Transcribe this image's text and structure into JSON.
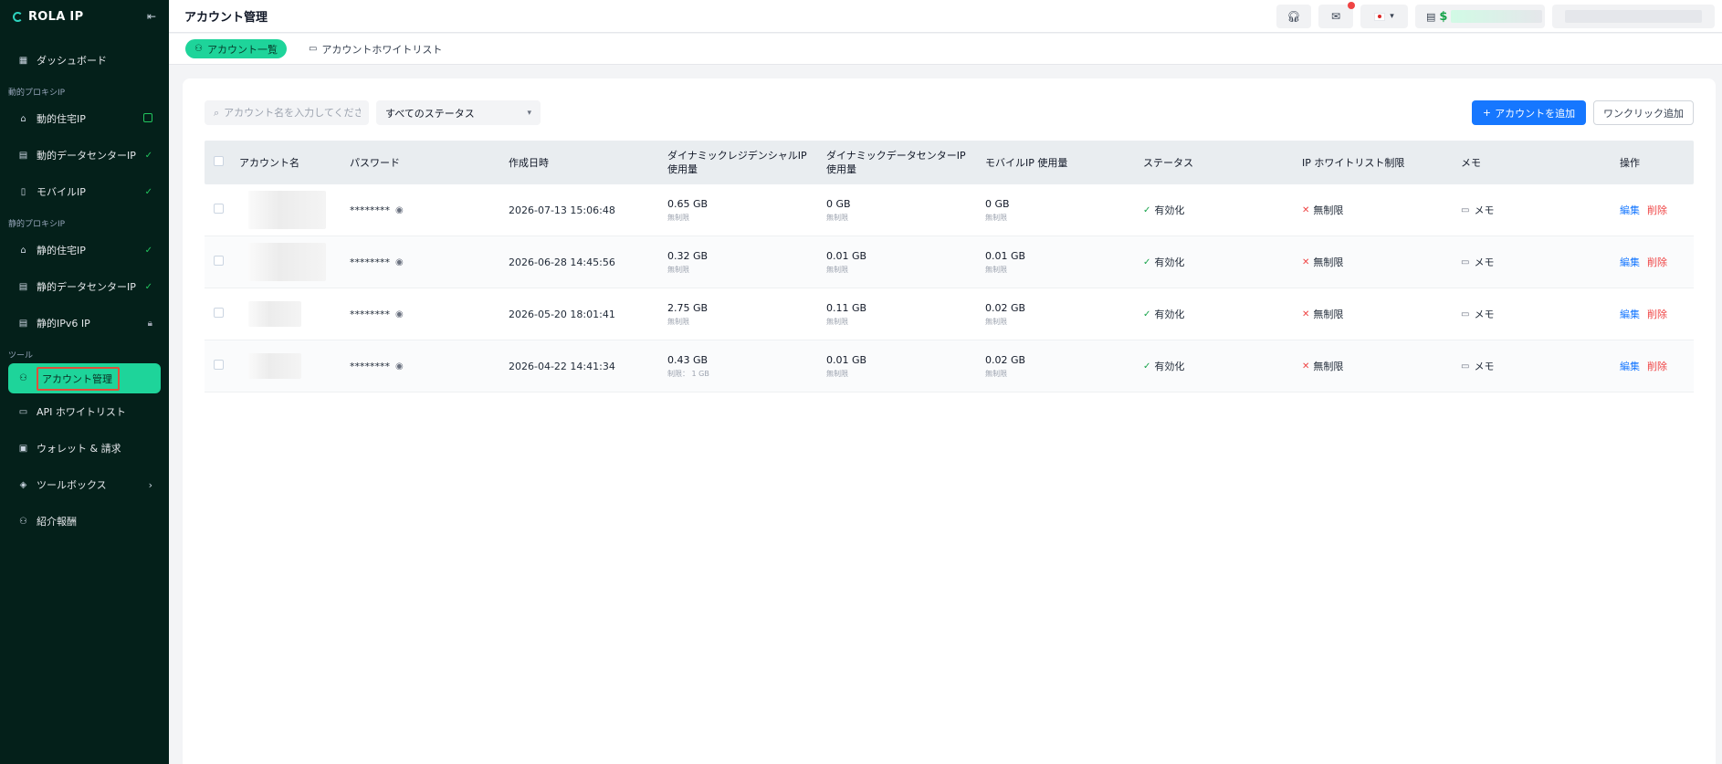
{
  "brand": {
    "name": "ROLA IP",
    "collapse_icon": "collapse-left-icon"
  },
  "sidebar": {
    "dashboard": "ダッシュボード",
    "dynamic_section": "動的プロキシIP",
    "dynamic_items": [
      {
        "label": "動的住宅IP",
        "icon": "home-icon",
        "trail": "badge"
      },
      {
        "label": "動的データセンターIP",
        "icon": "server-icon",
        "trail": "check"
      },
      {
        "label": "モバイルIP",
        "icon": "mobile-icon",
        "trail": "check"
      }
    ],
    "static_section": "静的プロキシIP",
    "static_items": [
      {
        "label": "静的住宅IP",
        "icon": "home-icon",
        "trail": "check"
      },
      {
        "label": "静的データセンターIP",
        "icon": "server-icon",
        "trail": "check"
      },
      {
        "label": "静的IPv6 IP",
        "icon": "server-icon",
        "trail": "lock"
      }
    ],
    "tools_section": "ツール",
    "tools_items": [
      {
        "label": "アカウント管理",
        "active": true
      },
      {
        "label": "API ホワイトリスト"
      },
      {
        "label": "ウォレット & 請求"
      },
      {
        "label": "ツールボックス"
      },
      {
        "label": "紹介報酬"
      }
    ]
  },
  "header": {
    "title": "アカウント管理",
    "currency": "$"
  },
  "tabs": [
    {
      "label": "アカウント一覧",
      "active": true
    },
    {
      "label": "アカウントホワイトリスト"
    }
  ],
  "toolbar": {
    "search_placeholder": "アカウント名を入力してくださ",
    "status_select": "すべてのステータス",
    "add_button": "アカウントを追加",
    "add_prefix": "+",
    "oneclick_button": "ワンクリック追加"
  },
  "table": {
    "headers": {
      "name": "アカウント名",
      "password": "パスワード",
      "created": "作成日時",
      "res_line1": "ダイナミックレジデンシャルIP",
      "res_line2": "使用量",
      "dc_line1": "ダイナミックデータセンターIP",
      "dc_line2": "使用量",
      "mobile": "モバイルIP 使用量",
      "status": "ステータス",
      "whitelist": "IP ホワイトリスト制限",
      "memo": "メモ",
      "ops": "操作"
    },
    "rows": [
      {
        "password": "********",
        "created": "2026-07-13 15:06:48",
        "res": "0.65 GB",
        "res_sub": "無制限",
        "dc": "0 GB",
        "dc_sub": "無制限",
        "mob": "0 GB",
        "mob_sub": "無制限",
        "status": "有効化",
        "whitelist": "無制限",
        "memo": "メモ",
        "edit": "編集",
        "delete": "削除"
      },
      {
        "password": "********",
        "created": "2026-06-28 14:45:56",
        "res": "0.32 GB",
        "res_sub": "無制限",
        "dc": "0.01 GB",
        "dc_sub": "無制限",
        "mob": "0.01 GB",
        "mob_sub": "無制限",
        "status": "有効化",
        "whitelist": "無制限",
        "memo": "メモ",
        "edit": "編集",
        "delete": "削除"
      },
      {
        "password": "********",
        "created": "2026-05-20 18:01:41",
        "res": "2.75 GB",
        "res_sub": "無制限",
        "dc": "0.11 GB",
        "dc_sub": "無制限",
        "mob": "0.02 GB",
        "mob_sub": "無制限",
        "status": "有効化",
        "whitelist": "無制限",
        "memo": "メモ",
        "edit": "編集",
        "delete": "削除"
      },
      {
        "password": "********",
        "created": "2026-04-22 14:41:34",
        "res": "0.43 GB",
        "res_sub": "制限： 1 GB",
        "dc": "0.01 GB",
        "dc_sub": "無制限",
        "mob": "0.02 GB",
        "mob_sub": "無制限",
        "status": "有効化",
        "whitelist": "無制限",
        "memo": "メモ",
        "edit": "編集",
        "delete": "削除"
      }
    ]
  },
  "colors": {
    "accent": "#1ed49a",
    "sidebar_bg": "#04201a",
    "primary": "#1677ff",
    "danger": "#ef4444"
  }
}
